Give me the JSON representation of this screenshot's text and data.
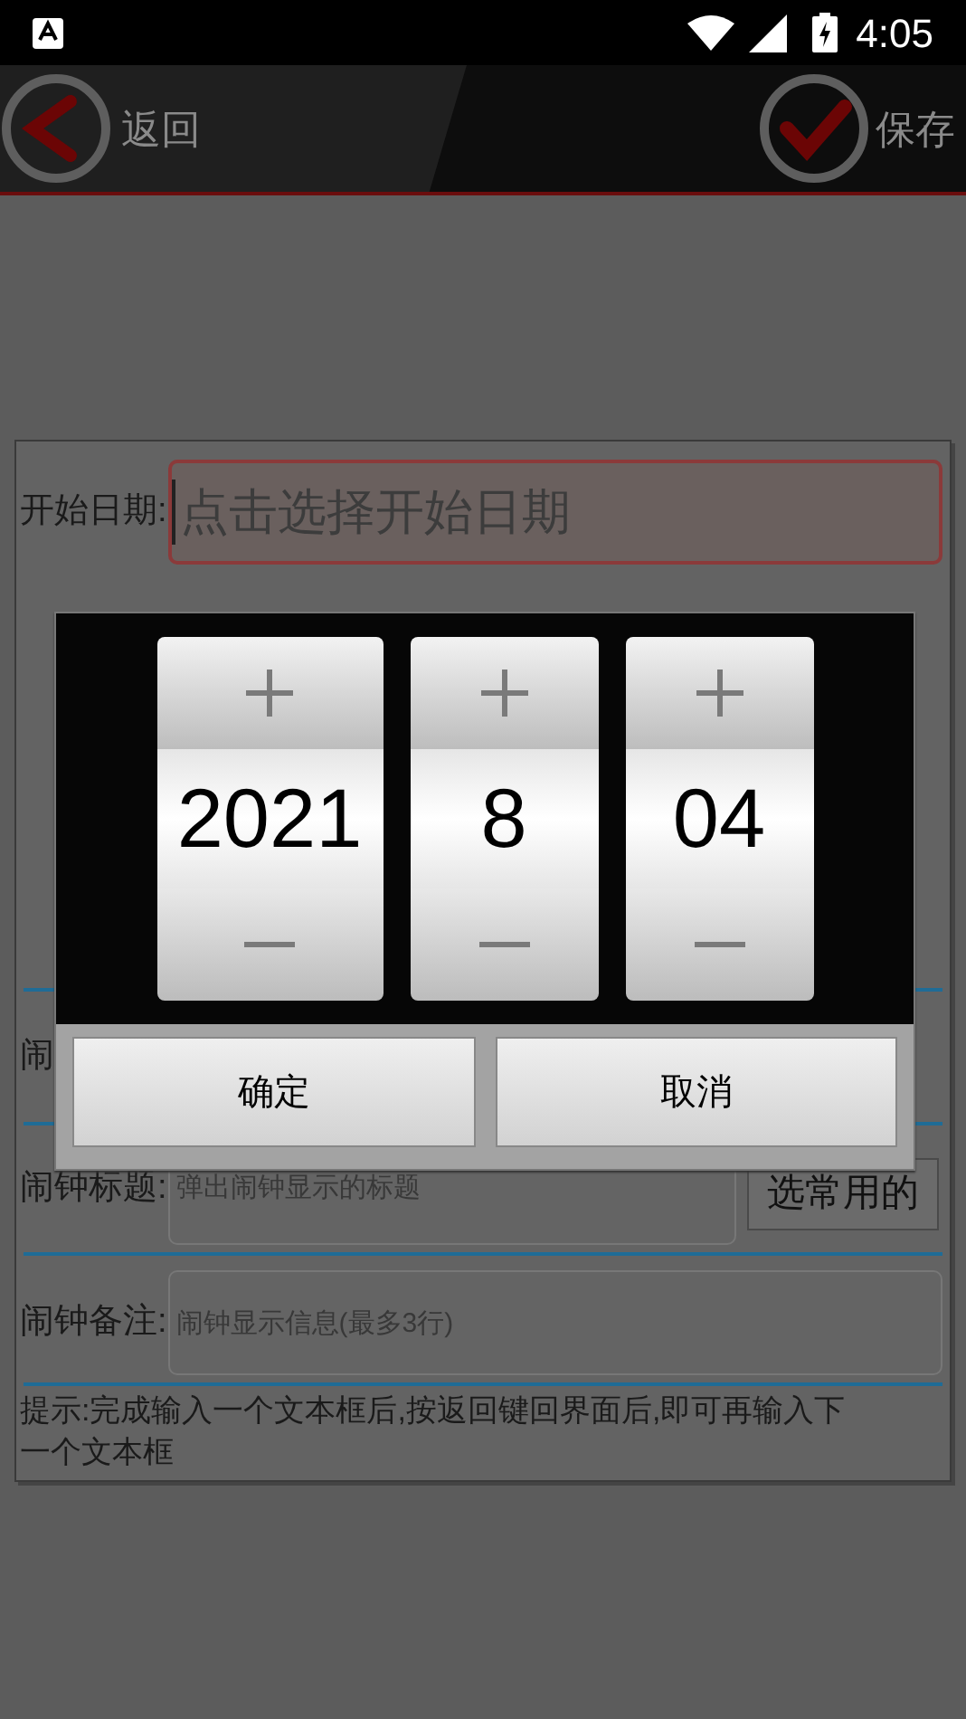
{
  "status_bar": {
    "time": "4:05"
  },
  "header": {
    "back": "返回",
    "save": "保存"
  },
  "form": {
    "start_date": {
      "label": "开始日期:",
      "placeholder": "点击选择开始日期",
      "focused": true
    },
    "row_2": {
      "label": "闹"
    },
    "title": {
      "label": "闹钟标题:",
      "placeholder": "弹出闹钟显示的标题",
      "button": "选常用的"
    },
    "note": {
      "label": "闹钟备注:",
      "placeholder": "闹钟显示信息(最多3行)"
    },
    "hint": "提示:完成输入一个文本框后,按返回键回界面后,即可再输入下一个文本框"
  },
  "date_picker": {
    "columns": [
      {
        "value": "2021"
      },
      {
        "value": "8"
      },
      {
        "value": "04"
      }
    ],
    "buttons": [
      "确定",
      "取消"
    ]
  }
}
